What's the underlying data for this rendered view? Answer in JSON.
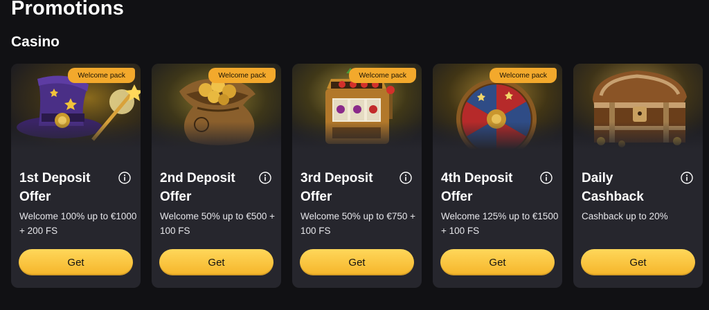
{
  "header": {
    "title": "Promotions",
    "section": "Casino"
  },
  "colors": {
    "background": "#111114",
    "card": "#26262d",
    "accent": "#f3a92c",
    "button": "#f5b52a"
  },
  "cards": [
    {
      "title": "1st Deposit Offer",
      "description": "Welcome 100% up to €1000 + 200 FS",
      "badge": "Welcome pack",
      "button": "Get",
      "art_icon": "wizard-hat-icon",
      "info_icon": "info-icon"
    },
    {
      "title": "2nd Deposit Offer",
      "description": "Welcome 50% up to €500 + 100 FS",
      "badge": "Welcome pack",
      "button": "Get",
      "art_icon": "coin-bag-icon",
      "info_icon": "info-icon"
    },
    {
      "title": "3rd Deposit Offer",
      "description": "Welcome 50% up to €750 + 100 FS",
      "badge": "Welcome pack",
      "button": "Get",
      "art_icon": "slot-machine-icon",
      "info_icon": "info-icon"
    },
    {
      "title": "4th Deposit Offer",
      "description": "Welcome 125% up to €1500 + 100 FS",
      "badge": "Welcome pack",
      "button": "Get",
      "art_icon": "prize-wheel-icon",
      "info_icon": "info-icon"
    },
    {
      "title": "Daily Cashback",
      "description": "Cashback up to 20%",
      "button": "Get",
      "art_icon": "treasure-chest-icon",
      "info_icon": "info-icon"
    }
  ]
}
